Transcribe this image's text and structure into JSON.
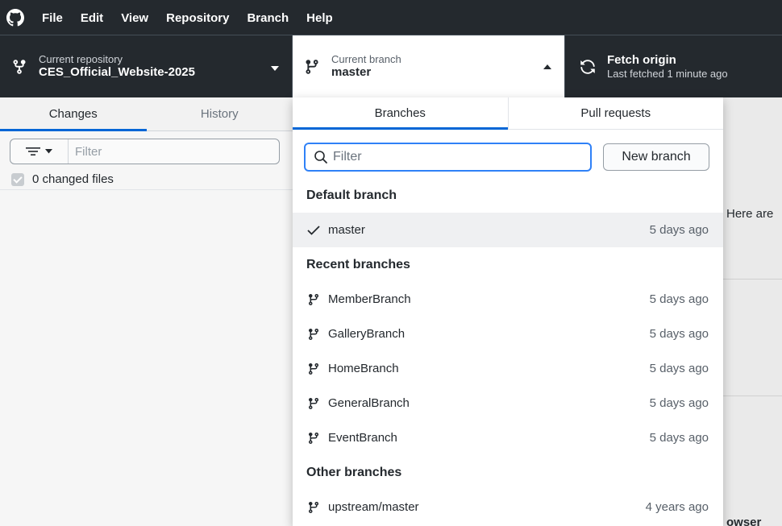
{
  "menu": [
    "File",
    "Edit",
    "View",
    "Repository",
    "Branch",
    "Help"
  ],
  "toolbar": {
    "repo_label": "Current repository",
    "repo_name": "CES_Official_Website-2025",
    "branch_label": "Current branch",
    "branch_name": "master",
    "fetch_title": "Fetch origin",
    "fetch_sub": "Last fetched 1 minute ago"
  },
  "left": {
    "tabs": [
      "Changes",
      "History"
    ],
    "filter_placeholder": "Filter",
    "changed_files": "0 changed files"
  },
  "popover": {
    "tabs": [
      "Branches",
      "Pull requests"
    ],
    "filter_placeholder": "Filter",
    "new_branch": "New branch",
    "default_heading": "Default branch",
    "default_branch": {
      "name": "master",
      "time": "5 days ago"
    },
    "recent_heading": "Recent branches",
    "recent": [
      {
        "name": "MemberBranch",
        "time": "5 days ago"
      },
      {
        "name": "GalleryBranch",
        "time": "5 days ago"
      },
      {
        "name": "HomeBranch",
        "time": "5 days ago"
      },
      {
        "name": "GeneralBranch",
        "time": "5 days ago"
      },
      {
        "name": "EventBranch",
        "time": "5 days ago"
      }
    ],
    "other_heading": "Other branches",
    "other": [
      {
        "name": "upstream/master",
        "time": "4 years ago"
      }
    ]
  },
  "right": {
    "text1": "Here are",
    "text2": "owser"
  },
  "colors": {
    "dark": "#24292e",
    "accent": "#0366d6",
    "focus": "#2f81f7"
  }
}
